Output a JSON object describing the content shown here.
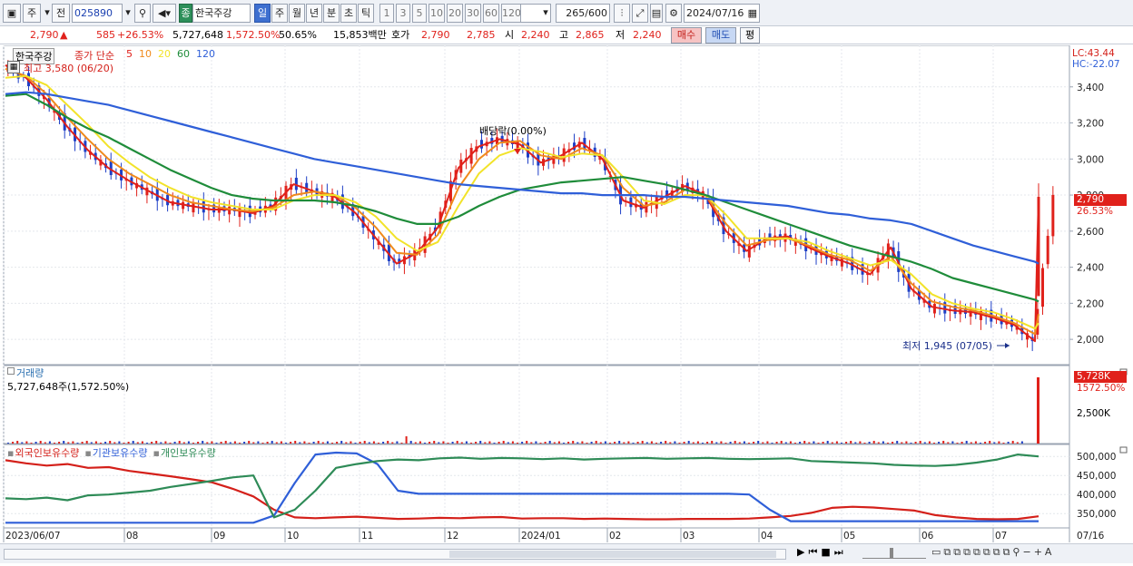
{
  "toolbar": {
    "market_select": "주",
    "prev_label": "전",
    "code": "025890",
    "stock_badge": "종",
    "stock_name": "한국주강",
    "periods": [
      "일",
      "주",
      "월",
      "년",
      "분",
      "초",
      "틱"
    ],
    "active_period": "일",
    "intervals": [
      "1",
      "3",
      "5",
      "10",
      "20",
      "30",
      "60",
      "120"
    ],
    "count": "265",
    "count_total": "/600",
    "date": "2024/07/16"
  },
  "quote": {
    "price": "2,790",
    "arrow": "▲",
    "change": "585",
    "change_pct": "+26.53%",
    "volume": "5,727,648",
    "volume_pct": "1,572.50%",
    "turnover": "50.65%",
    "amount": "15,853백만",
    "hoga_label": "호가",
    "hoga_ask": "2,790",
    "hoga_bid": "2,785",
    "open_label": "시",
    "open": "2,240",
    "high_label": "고",
    "high": "2,865",
    "low_label": "저",
    "low": "2,240",
    "buy_label": "매수",
    "sell_label": "매도",
    "flat_label": "평"
  },
  "price_pane": {
    "title": "한국주강",
    "ma_label": "종가 단순",
    "ma_periods": [
      {
        "label": "5",
        "color": "#e0211b"
      },
      {
        "label": "10",
        "color": "#f08a1c"
      },
      {
        "label": "20",
        "color": "#f2e32a"
      },
      {
        "label": "60",
        "color": "#1f8c3a"
      },
      {
        "label": "120",
        "color": "#2f5fd8"
      }
    ],
    "high_note": "최고 3,580 (06/20)",
    "low_note": "최저 1,945 (07/05)",
    "dividend_note": "배당락(0.00%)",
    "lc": "LC:43.44",
    "hc": "HC:-22.07",
    "last_price_tag": "2,790",
    "last_pct_tag": "26.53%",
    "y_ticks": [
      "3,400",
      "3,200",
      "3,000",
      "2,800",
      "2,600",
      "2,400",
      "2,200",
      "2,000"
    ]
  },
  "volume_pane": {
    "title": "거래량",
    "value": "5,727,648주(1,572.50%)",
    "tag_value": "5,728K",
    "tag_pct": "1572.50%",
    "tick": "2,500K"
  },
  "holding_pane": {
    "series": [
      {
        "name": "외국인보유수량",
        "color": "#d4201a"
      },
      {
        "name": "기관보유수량",
        "color": "#2f5fd8"
      },
      {
        "name": "개인보유수량",
        "color": "#2e8b57"
      }
    ],
    "y_ticks": [
      "500,000",
      "450,000",
      "400,000",
      "350,000"
    ]
  },
  "x_axis": {
    "labels": [
      "2023/06/07",
      "08",
      "09",
      "10",
      "11",
      "12",
      "2024/01",
      "02",
      "03",
      "04",
      "05",
      "06",
      "07"
    ],
    "right_label": "07/16"
  },
  "chart_data": {
    "type": "candlestick",
    "xlabel": "",
    "ylabel": "",
    "ylim": [
      1900,
      3600
    ],
    "series": [
      {
        "name": "5",
        "values": [
          3520,
          3450,
          3330,
          3180,
          3050,
          2950,
          2880,
          2820,
          2760,
          2740,
          2720,
          2720,
          2700,
          2740,
          2860,
          2820,
          2790,
          2700,
          2560,
          2420,
          2480,
          2620,
          2950,
          3070,
          3110,
          3080,
          2980,
          3020,
          3090,
          3000,
          2770,
          2730,
          2790,
          2850,
          2800,
          2600,
          2490,
          2560,
          2570,
          2510,
          2460,
          2420,
          2360,
          2510,
          2280,
          2180,
          2160,
          2150,
          2120,
          2080,
          1990,
          2790
        ]
      },
      {
        "name": "10",
        "values": [
          3500,
          3460,
          3360,
          3230,
          3110,
          3000,
          2920,
          2860,
          2800,
          2760,
          2740,
          2720,
          2710,
          2730,
          2800,
          2820,
          2800,
          2730,
          2620,
          2480,
          2470,
          2580,
          2840,
          3000,
          3090,
          3100,
          3020,
          3000,
          3060,
          3020,
          2840,
          2740,
          2760,
          2830,
          2800,
          2640,
          2520,
          2550,
          2560,
          2520,
          2470,
          2440,
          2380,
          2460,
          2310,
          2210,
          2180,
          2160,
          2130,
          2090,
          2030,
          2140
        ]
      },
      {
        "name": "20",
        "values": [
          3450,
          3460,
          3410,
          3300,
          3190,
          3070,
          2980,
          2900,
          2840,
          2790,
          2760,
          2740,
          2720,
          2720,
          2770,
          2800,
          2800,
          2760,
          2680,
          2560,
          2490,
          2540,
          2740,
          2920,
          3020,
          3060,
          3040,
          3010,
          3030,
          3020,
          2900,
          2770,
          2750,
          2800,
          2800,
          2690,
          2560,
          2560,
          2560,
          2540,
          2490,
          2450,
          2410,
          2440,
          2360,
          2250,
          2200,
          2170,
          2150,
          2110,
          2060,
          2090
        ]
      },
      {
        "name": "60",
        "values": [
          3350,
          3360,
          3300,
          3230,
          3170,
          3120,
          3060,
          3000,
          2940,
          2890,
          2840,
          2800,
          2780,
          2770,
          2770,
          2770,
          2760,
          2740,
          2710,
          2670,
          2640,
          2640,
          2680,
          2740,
          2790,
          2830,
          2850,
          2870,
          2880,
          2890,
          2900,
          2880,
          2860,
          2830,
          2800,
          2760,
          2720,
          2680,
          2640,
          2600,
          2560,
          2520,
          2490,
          2460,
          2430,
          2390,
          2340,
          2310,
          2280,
          2250,
          2220,
          2210
        ]
      },
      {
        "name": "120",
        "values": [
          3360,
          3370,
          3360,
          3340,
          3320,
          3300,
          3270,
          3240,
          3210,
          3180,
          3150,
          3120,
          3090,
          3060,
          3030,
          3000,
          2980,
          2960,
          2940,
          2920,
          2900,
          2880,
          2860,
          2850,
          2840,
          2830,
          2820,
          2810,
          2810,
          2800,
          2800,
          2800,
          2790,
          2790,
          2780,
          2770,
          2760,
          2750,
          2740,
          2720,
          2700,
          2690,
          2670,
          2660,
          2640,
          2600,
          2560,
          2520,
          2490,
          2460,
          2430,
          2420
        ]
      }
    ]
  }
}
